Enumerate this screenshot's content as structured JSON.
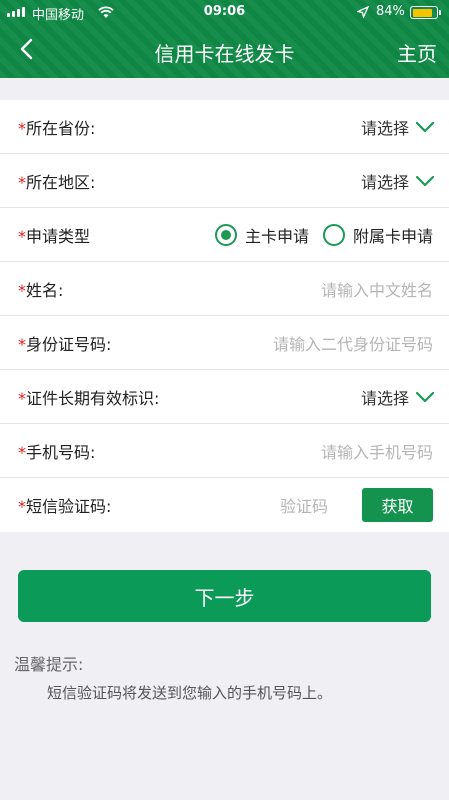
{
  "status_bar": {
    "carrier": "中国移动",
    "time": "09:06",
    "battery": "84%",
    "icons": [
      "signal-icon",
      "wifi-icon",
      "location-arrow-icon",
      "battery-icon"
    ]
  },
  "nav": {
    "title": "信用卡在线发卡",
    "home_label": "主页",
    "back_icon": "chevron-left-icon"
  },
  "form": {
    "required_mark": "*",
    "province": {
      "label": "所在省份:",
      "value": "请选择"
    },
    "region": {
      "label": "所在地区:",
      "value": "请选择"
    },
    "apply_type": {
      "label": "申请类型",
      "options": [
        {
          "label": "主卡申请",
          "selected": true
        },
        {
          "label": "附属卡申请",
          "selected": false
        }
      ]
    },
    "name": {
      "label": "姓名:",
      "placeholder": "请输入中文姓名"
    },
    "id_number": {
      "label": "身份证号码:",
      "placeholder": "请输入二代身份证号码"
    },
    "id_long_term": {
      "label": "证件长期有效标识:",
      "value": "请选择"
    },
    "phone": {
      "label": "手机号码:",
      "placeholder": "请输入手机号码"
    },
    "sms_code": {
      "label": "短信验证码:",
      "placeholder": "验证码",
      "button": "获取"
    }
  },
  "next_button": "下一步",
  "tips": {
    "title": "温馨提示:",
    "text": "短信验证码将发送到您输入的手机号码上。"
  },
  "colors": {
    "header_green": "#0f8a45",
    "accent_green": "#14934f",
    "required_red": "#e02020",
    "battery_yellow": "#f5c400"
  }
}
